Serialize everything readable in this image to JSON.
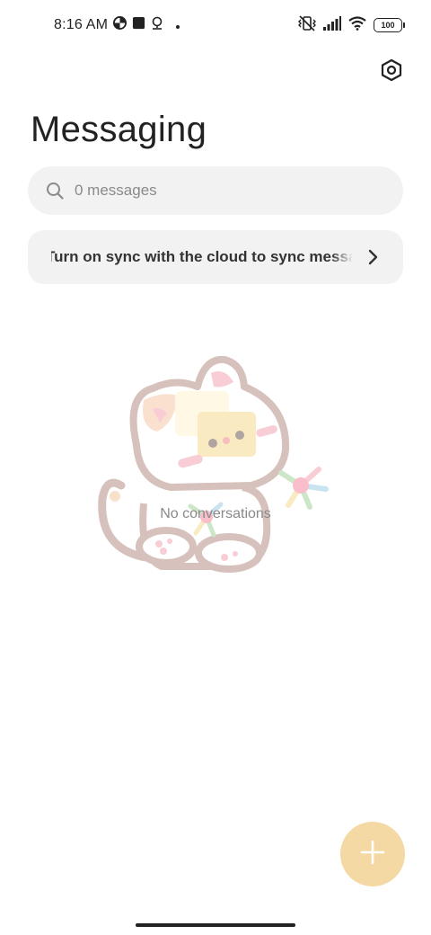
{
  "status_bar": {
    "time": "8:16 AM",
    "battery": "100",
    "icons_left": [
      "data-saver-icon",
      "notification-square-icon",
      "location-pin-icon",
      "dot-icon"
    ],
    "icons_right": [
      "vibrate-off-icon",
      "signal-icon",
      "wifi-icon",
      "battery-icon"
    ]
  },
  "header": {
    "title": "Messaging",
    "settings_icon": "settings-hex-icon"
  },
  "search": {
    "placeholder": "0 messages",
    "icon": "search-icon"
  },
  "sync_banner": {
    "text": "Turn on sync with the cloud to sync messages",
    "icon": "chevron-right-icon"
  },
  "empty_state": {
    "text": "No conversations",
    "illustration": "cat-illustration"
  },
  "fab": {
    "icon": "plus-icon",
    "color": "#f4d9a4"
  },
  "colors": {
    "background": "#ffffff",
    "surface": "#f2f2f2",
    "accent": "#f4d9a4"
  }
}
